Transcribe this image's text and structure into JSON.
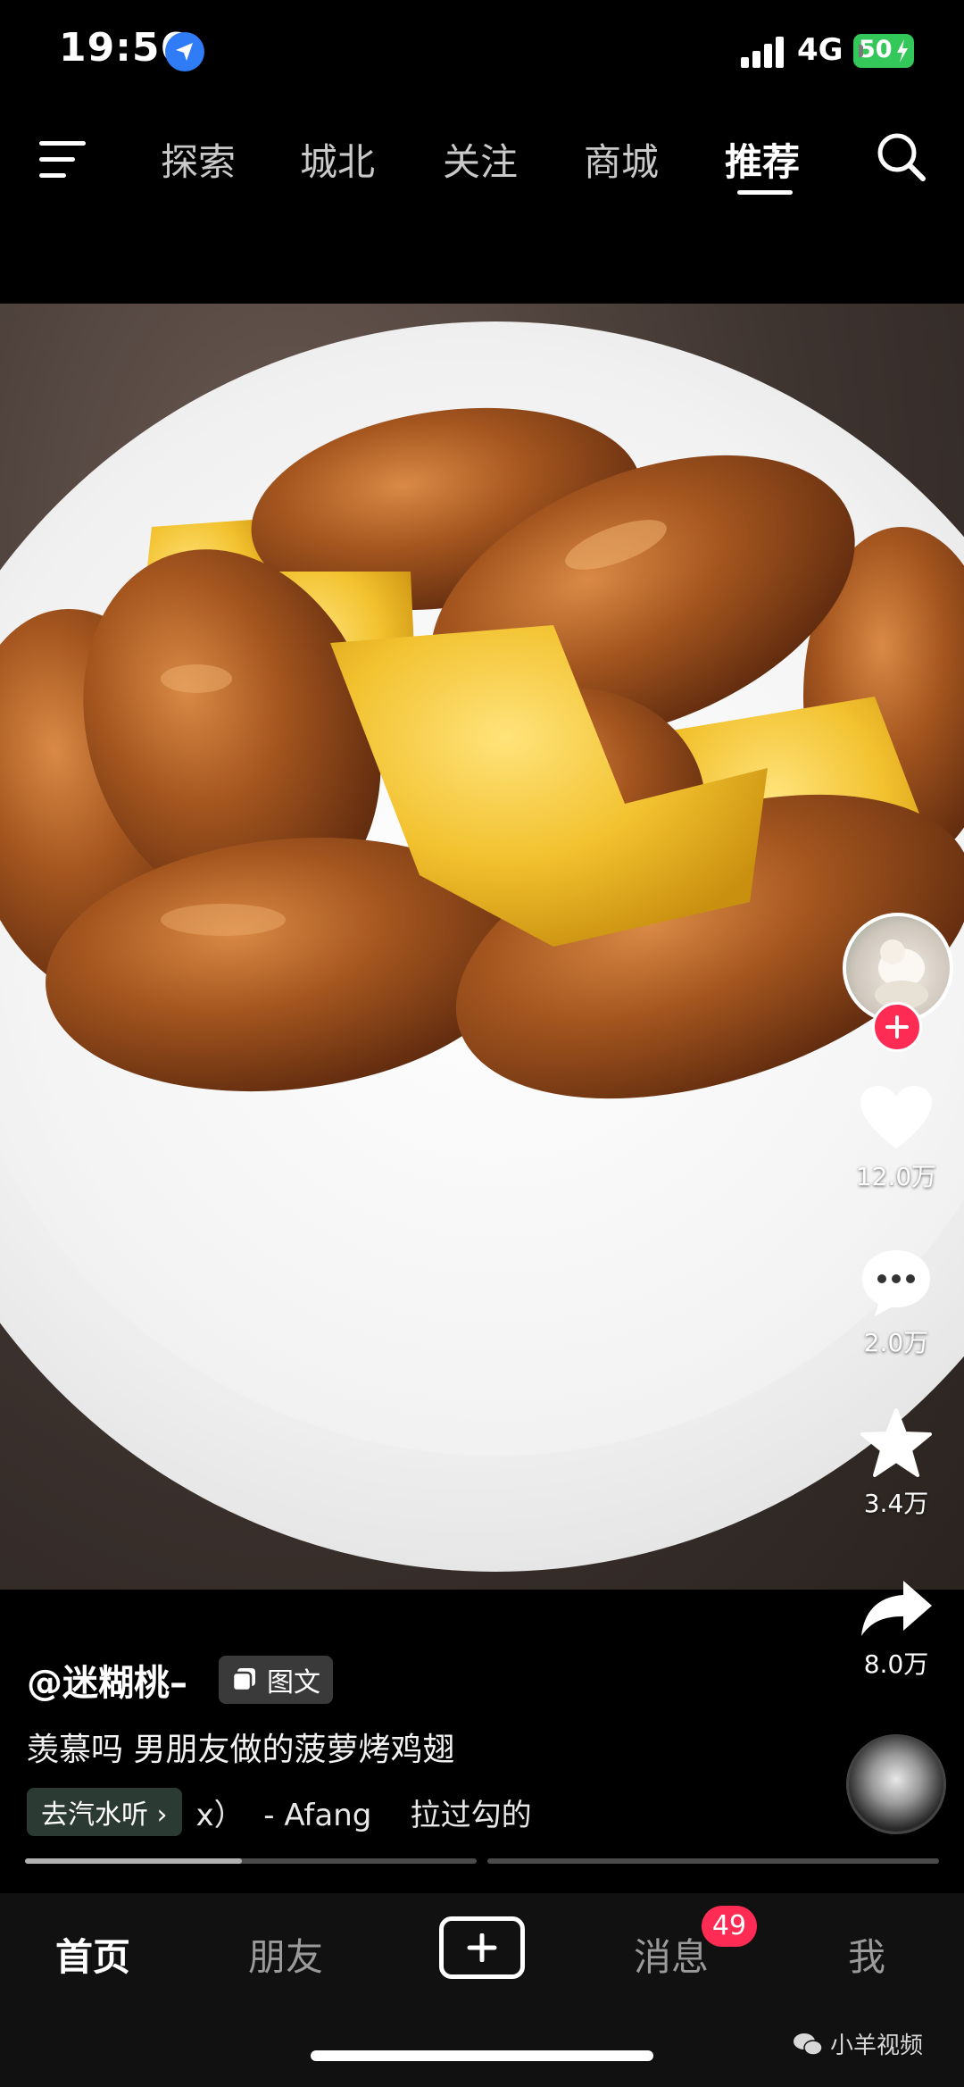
{
  "status_bar": {
    "time": "19:56",
    "network": "4G",
    "battery": "50"
  },
  "top_nav": {
    "tabs": [
      {
        "label": "探索",
        "active": false
      },
      {
        "label": "城北",
        "active": false
      },
      {
        "label": "关注",
        "active": false
      },
      {
        "label": "商城",
        "active": false
      },
      {
        "label": "推荐",
        "active": true
      }
    ]
  },
  "post": {
    "author": "@迷糊桃–",
    "type_badge": "图文",
    "caption": "羡慕吗 男朋友做的菠萝烤鸡翅",
    "music_chip": "去汽水听 ›",
    "music_text": "x）  - Afang    拉过勾的",
    "likes": "12.0万",
    "comments": "2.0万",
    "favorites": "3.4万",
    "shares": "8.0万",
    "image_progress": 0.48
  },
  "bottom_nav": {
    "home": "首页",
    "friends": "朋友",
    "messages": "消息",
    "messages_badge": "49",
    "me": "我"
  },
  "watermark": "小羊视频",
  "colors": {
    "accent": "#fe2c55",
    "battery": "#34c759",
    "location": "#2f7cf6"
  }
}
